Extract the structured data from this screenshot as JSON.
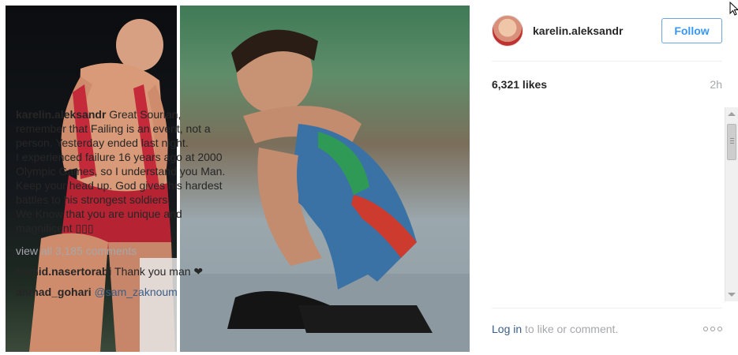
{
  "post": {
    "media": {
      "left_image_icon": "wrestler-red-singlet-photo",
      "right_image_icon": "wrestler-blue-singlet-kneeling-photo"
    },
    "header": {
      "username": "karelin.aleksandr",
      "avatar_icon": "profile-avatar",
      "follow_label": "Follow"
    },
    "likes": "6,321 likes",
    "time_ago": "2h",
    "caption": {
      "username": "karelin.aleksandr",
      "text": "Great Sourian, remember that Failing is an event, not a person. Yesterday ended last night.\nI experienced failure 16 years ago at 2000 Olympic Games, so I understand you Man. Keep your head up. God gives his hardest battles to his strongest soldiers.\nWe Know that you are unique and magnificent ▯▯▯"
    },
    "view_all": "view all 3,185 comments",
    "comments": [
      {
        "username": "hamid.nasertorabi",
        "text": "Thank you man ❤"
      },
      {
        "username": "ahmad_gohari",
        "text": "@sam_zaknoum"
      }
    ],
    "footer": {
      "login": "Log in",
      "rest": " to like or comment.",
      "more_icon": "more-options-icon"
    }
  },
  "colors": {
    "accent": "#3897f0",
    "link": "#3b5e87",
    "muted": "#a5a7aa",
    "text": "#262626"
  }
}
